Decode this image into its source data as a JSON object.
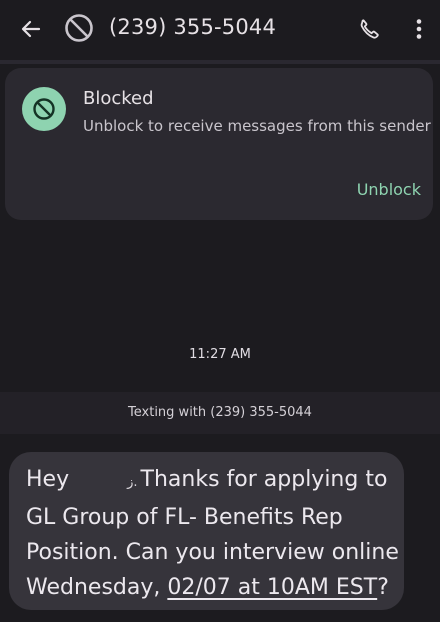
{
  "header": {
    "title": "(239) 355-5044"
  },
  "blocked_card": {
    "title": "Blocked",
    "subtitle": "Unblock to receive messages from this sender",
    "unblock_label": "Unblock"
  },
  "conversation": {
    "timestamp": "11:27 AM",
    "texting_with": "Texting with (239) 355-5044",
    "message": {
      "line1_start": "Hey",
      "line1_mark": "ز.",
      "line1_end": "Thanks for applying to",
      "line2": "GL Group of FL- Benefits Rep",
      "line3": "Position. Can you interview online",
      "line4_start": "Wednesday, ",
      "line4_link": "02/07 at 10AM EST",
      "line4_end": "?"
    }
  },
  "colors": {
    "background": "#1c1b1f",
    "card": "#2b2930",
    "accent": "#8ed3b0",
    "bubble": "#36343b"
  },
  "icons": [
    "back-arrow-icon",
    "blocked-icon",
    "phone-icon",
    "more-vert-icon"
  ]
}
